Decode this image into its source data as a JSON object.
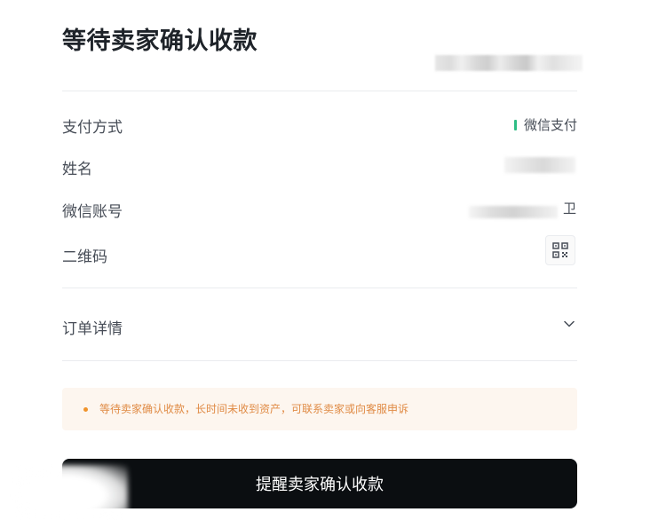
{
  "title": "等待卖家确认收款",
  "payment": {
    "method_label": "支付方式",
    "method_value": "微信支付",
    "method_color": "#2ebd85",
    "name_label": "姓名",
    "account_label": "微信账号",
    "account_tail": "卫",
    "qr_label": "二维码",
    "qr_icon": "qr-code-icon"
  },
  "order": {
    "details_label": "订单详情",
    "toggle_icon": "chevron-down-icon"
  },
  "notice": {
    "text": "等待卖家确认收款，长时间未收到资产，可联系卖家或向客服申诉",
    "color": "#e08b45"
  },
  "action": {
    "button_label": "提醒卖家确认收款"
  }
}
